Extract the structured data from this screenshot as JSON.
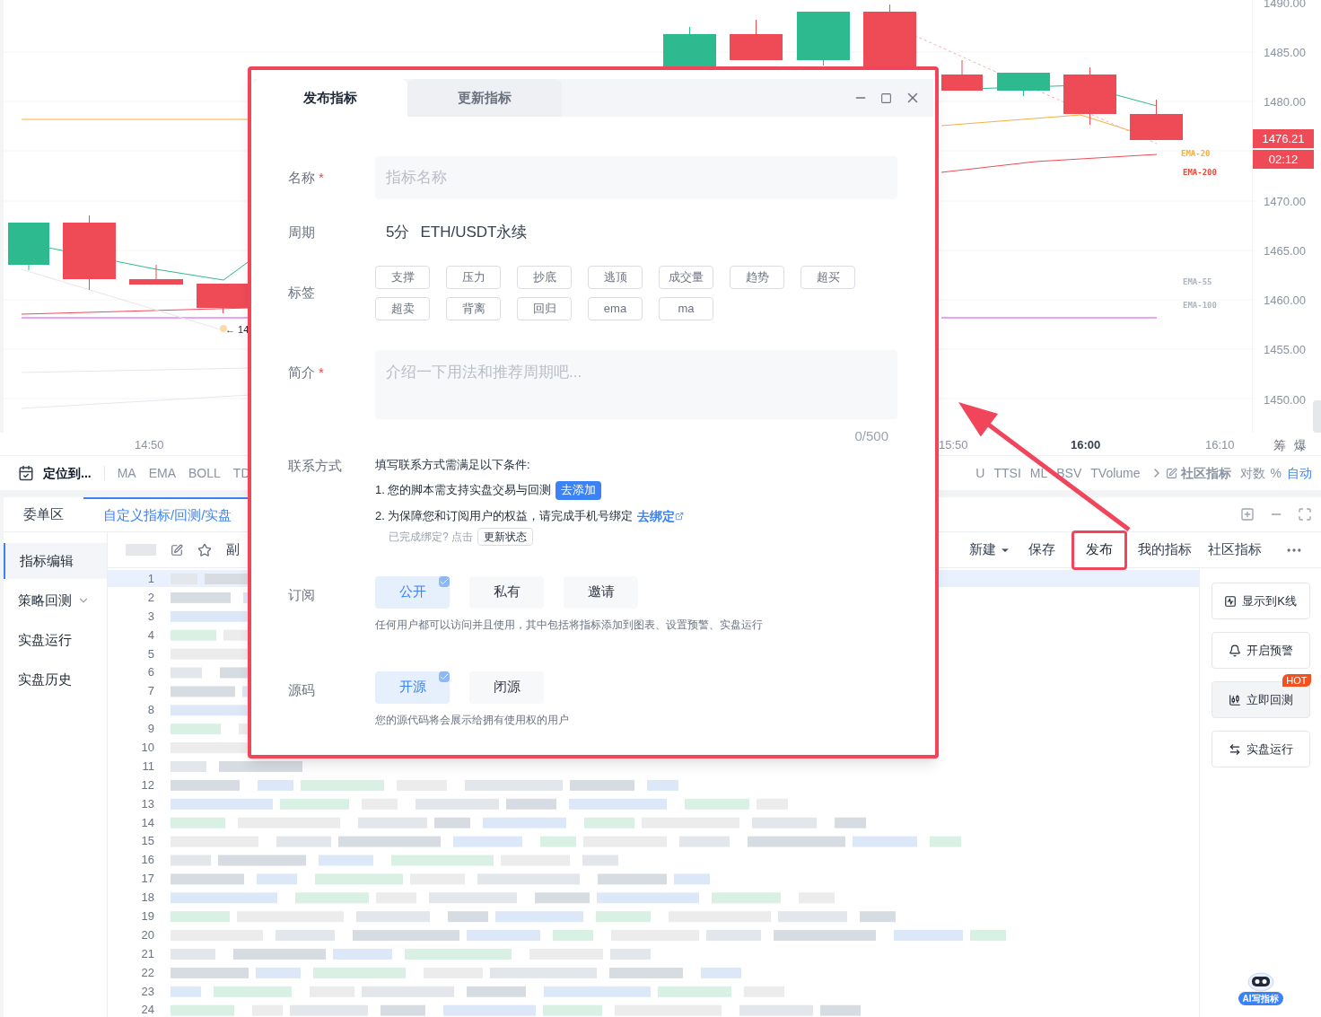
{
  "chart": {
    "price_labels": [
      "1490.00",
      "1485.00",
      "1480.00",
      "1470.00",
      "1465.00",
      "1460.00",
      "1455.00",
      "1450.00"
    ],
    "last_price": "1476.21",
    "countdown": "02:12",
    "marker": "← 14",
    "line_labels": [
      {
        "text": "EMA-20",
        "color": "#f5b041"
      },
      {
        "text": "EMA-200",
        "color": "#e74c3c"
      },
      {
        "text": "EMA-55",
        "color": "#b0b6bf"
      },
      {
        "text": "EMA-100",
        "color": "#b0b6bf"
      }
    ],
    "time_labels": [
      {
        "text": "14:50",
        "bold": false
      },
      {
        "text": "15:50",
        "bold": false
      },
      {
        "text": "16:00",
        "bold": true
      },
      {
        "text": "16:10",
        "bold": false
      }
    ],
    "side_labels": [
      "筹",
      "爆"
    ]
  },
  "indicator_bar": {
    "locate": "定位到...",
    "left": [
      "MA",
      "EMA",
      "BOLL",
      "TD"
    ],
    "right": [
      "U",
      "TTSI",
      "ML",
      "BSV",
      "TVolume"
    ],
    "community": "社区指标",
    "log": "对数",
    "percent": "%",
    "auto": "自动"
  },
  "panel": {
    "tabs": [
      {
        "label": "委单区",
        "selected": false
      },
      {
        "label": "自定义指标/回测/实盘",
        "selected": true
      }
    ],
    "menu": [
      {
        "label": "指标编辑",
        "selected": true,
        "expandable": false
      },
      {
        "label": "策略回测",
        "selected": false,
        "expandable": true
      },
      {
        "label": "实盘运行",
        "selected": false,
        "expandable": false
      },
      {
        "label": "实盘历史",
        "selected": false,
        "expandable": false
      }
    ],
    "editor_label": "副",
    "actions": [
      {
        "label": "新建",
        "kind": "dropdown"
      },
      {
        "label": "保存",
        "kind": "plain"
      },
      {
        "label": "发布",
        "kind": "highlighted"
      },
      {
        "label": "我的指标",
        "kind": "plain"
      },
      {
        "label": "社区指标",
        "kind": "plain"
      }
    ],
    "line_numbers": [
      "1",
      "2",
      "3",
      "4",
      "5",
      "6",
      "7",
      "8",
      "9",
      "10",
      "11",
      "12",
      "13",
      "14",
      "15",
      "16",
      "17",
      "18",
      "19",
      "20",
      "21",
      "22",
      "23",
      "24"
    ],
    "side_actions": [
      {
        "label": "显示到K线",
        "kind": "chart"
      },
      {
        "label": "开启预警",
        "kind": "bell"
      },
      {
        "label": "立即回测",
        "kind": "backtest",
        "badge": "HOT"
      },
      {
        "label": "实盘运行",
        "kind": "swap"
      }
    ],
    "assistant_label": "AI写指标"
  },
  "publish_dialog": {
    "tabs": [
      {
        "label": "发布指标",
        "selected": true
      },
      {
        "label": "更新指标",
        "selected": false
      }
    ],
    "name": {
      "label": "名称",
      "required_mark": "*",
      "placeholder": "指标名称"
    },
    "period": {
      "label": "周期",
      "value": "5分",
      "symbol": "ETH/USDT永续"
    },
    "tags": {
      "label": "标签",
      "items": [
        "支撑",
        "压力",
        "抄底",
        "逃顶",
        "成交量",
        "趋势",
        "超买",
        "超卖",
        "背离",
        "回归",
        "ema",
        "ma"
      ]
    },
    "intro": {
      "label": "简介",
      "required_mark": "*",
      "placeholder": "介绍一下用法和推荐周期吧...",
      "counter": "0/500"
    },
    "contact": {
      "label": "联系方式",
      "intro": "填写联系方式需满足以下条件:",
      "conditions": [
        {
          "text": "1. 您的脚本需支持实盘交易与回测",
          "action": "去添加",
          "kind": "button"
        },
        {
          "text": "2. 为保障您和订阅用户的权益，请完成手机号绑定",
          "action": "去绑定",
          "kind": "link"
        }
      ],
      "hint": "已完成绑定? 点击",
      "hint_button": "更新状态"
    },
    "subscription": {
      "label": "订阅",
      "options": [
        {
          "label": "公开",
          "selected": true
        },
        {
          "label": "私有",
          "selected": false
        },
        {
          "label": "邀请",
          "selected": false
        }
      ],
      "note": "任何用户都可以访问并且使用，其中包括将指标添加到图表、设置预警、实盘运行"
    },
    "source": {
      "label": "源码",
      "options": [
        {
          "label": "开源",
          "selected": true
        },
        {
          "label": "闭源",
          "selected": false
        }
      ],
      "note": "您的源代码将会展示给拥有使用权的用户"
    }
  }
}
